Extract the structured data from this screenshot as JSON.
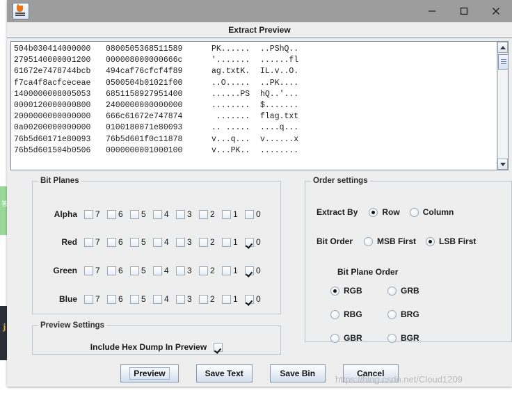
{
  "window": {
    "app_icon": "java-coffee-cup-icon",
    "minimize_label": "─",
    "maximize_label": "□",
    "close_label": "✕"
  },
  "dialog": {
    "title": "Extract Preview"
  },
  "hex_dump": {
    "lines": [
      {
        "hex1": "504b030414000000",
        "hex2": "0800505368511589",
        "ascii1": "PK......",
        "ascii2": "..PShQ.."
      },
      {
        "hex1": "2795140000001200",
        "hex2": "000008000000666c",
        "ascii1": "'.......",
        "ascii2": "......fl"
      },
      {
        "hex1": "61672e7478744bcb",
        "hex2": "494caf76cfcf4f89",
        "ascii1": "ag.txtK.",
        "ascii2": "IL.v..O."
      },
      {
        "hex1": "f7ca4f8acfceceae",
        "hex2": "0500504b01021f00",
        "ascii1": "..O.....",
        "ascii2": "..PK...."
      },
      {
        "hex1": "1400000008005053",
        "hex2": "6851158927951400",
        "ascii1": "......PS",
        "ascii2": "hQ..'..."
      },
      {
        "hex1": "0000120000000800",
        "hex2": "2400000000000000",
        "ascii1": "........",
        "ascii2": "$......."
      },
      {
        "hex1": "2000000000000000",
        "hex2": "666c61672e747874",
        "ascii1": " .......",
        "ascii2": "flag.txt"
      },
      {
        "hex1": "0a00200000000000",
        "hex2": "0100180071e80093",
        "ascii1": ".. .....",
        "ascii2": "....q..."
      },
      {
        "hex1": "76b5d60171e80093",
        "hex2": "76b5d601f0c11878",
        "ascii1": "v...q...",
        "ascii2": "v......x"
      },
      {
        "hex1": "76b5d601504b0506",
        "hex2": "0000000001000100",
        "ascii1": "v...PK..",
        "ascii2": "........"
      }
    ]
  },
  "scrollbar": {
    "up_label": "scroll-up",
    "down_label": "scroll-down"
  },
  "bit_planes": {
    "group_label": "Bit Planes",
    "bit_numbers": [
      "7",
      "6",
      "5",
      "4",
      "3",
      "2",
      "1",
      "0"
    ],
    "rows": [
      {
        "channel": "Alpha",
        "checked": [
          false,
          false,
          false,
          false,
          false,
          false,
          false,
          false
        ]
      },
      {
        "channel": "Red",
        "checked": [
          false,
          false,
          false,
          false,
          false,
          false,
          false,
          true
        ]
      },
      {
        "channel": "Green",
        "checked": [
          false,
          false,
          false,
          false,
          false,
          false,
          false,
          true
        ]
      },
      {
        "channel": "Blue",
        "checked": [
          false,
          false,
          false,
          false,
          false,
          false,
          false,
          true
        ]
      }
    ]
  },
  "order_settings": {
    "group_label": "Order settings",
    "extract_by": {
      "caption": "Extract By",
      "options": [
        "Row",
        "Column"
      ],
      "selected": "Row"
    },
    "bit_order": {
      "caption": "Bit Order",
      "options": [
        "MSB First",
        "LSB First"
      ],
      "selected": "LSB First"
    },
    "bit_plane_order": {
      "caption": "Bit Plane Order",
      "options": [
        "RGB",
        "GRB",
        "RBG",
        "BRG",
        "GBR",
        "BGR"
      ],
      "selected": "RGB"
    }
  },
  "preview_settings": {
    "group_label": "Preview Settings",
    "include_hex_dump_label": "Include Hex Dump In Preview",
    "include_hex_dump_checked": true
  },
  "buttons": {
    "preview": "Preview",
    "save_text": "Save Text",
    "save_bin": "Save Bin",
    "cancel": "Cancel"
  },
  "watermark": "https://blog.csdn.net/Cloud1209",
  "background": {
    "green_text": "答案",
    "dark_text": "j"
  },
  "colors": {
    "titlebar": "#9d9d9d",
    "panel": "#eeeeee",
    "border": "#7a8a99",
    "group_border": "#b8c4d0",
    "button_face": "#d3dfee",
    "watermark": "#b9b9b9"
  }
}
